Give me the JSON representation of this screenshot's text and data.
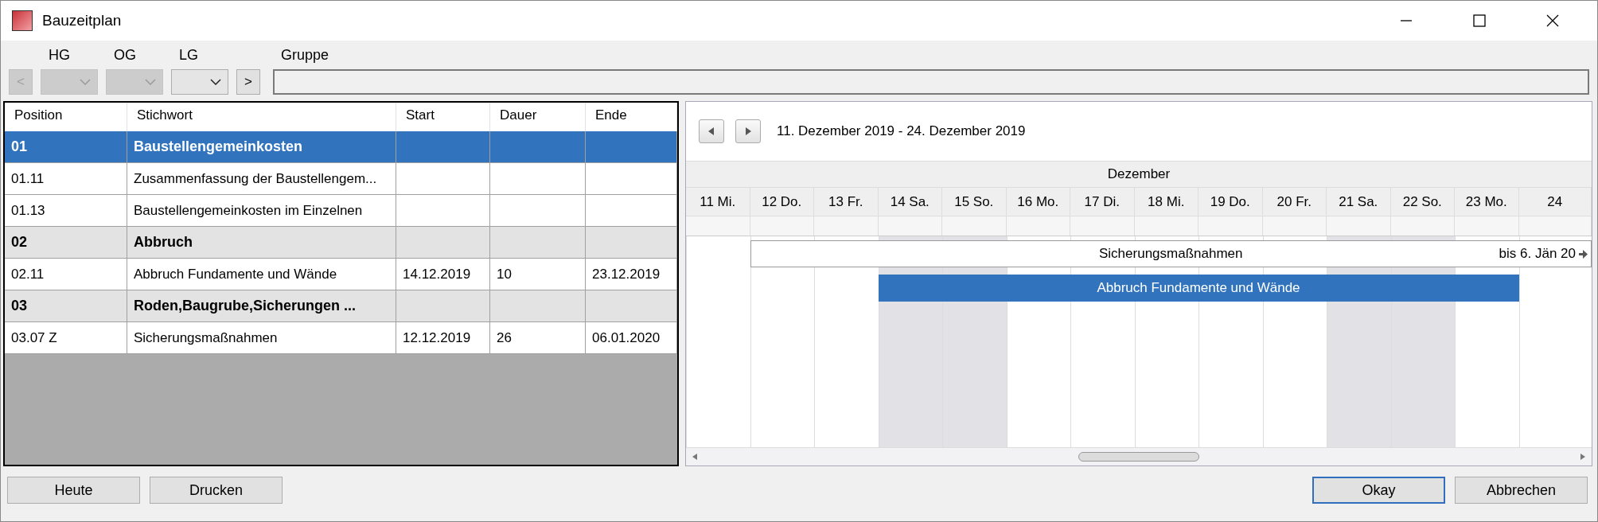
{
  "window": {
    "title": "Bauzeitplan"
  },
  "filters": [
    {
      "label": "HG",
      "disabled": true
    },
    {
      "label": "OG",
      "disabled": true
    },
    {
      "label": "LG",
      "disabled": false
    }
  ],
  "nav": {
    "prev": {
      "label": "<",
      "disabled": true
    },
    "next": {
      "label": ">",
      "disabled": false
    }
  },
  "group": {
    "label": "Gruppe"
  },
  "table": {
    "columns": [
      "Position",
      "Stichwort",
      "Start",
      "Dauer",
      "Ende"
    ],
    "rows": [
      {
        "kind": "group",
        "selected": true,
        "cells": [
          "01",
          "Baustellengemeinkosten",
          "",
          "",
          ""
        ]
      },
      {
        "kind": "item",
        "selected": false,
        "cells": [
          "01.11",
          "Zusammenfassung der Baustellengem...",
          "",
          "",
          ""
        ]
      },
      {
        "kind": "item",
        "selected": false,
        "cells": [
          "01.13",
          "Baustellengemeinkosten im Einzelnen",
          "",
          "",
          ""
        ]
      },
      {
        "kind": "group",
        "selected": false,
        "cells": [
          "02",
          "Abbruch",
          "",
          "",
          ""
        ]
      },
      {
        "kind": "item",
        "selected": false,
        "cells": [
          "02.11",
          "Abbruch Fundamente und Wände",
          "14.12.2019",
          "10",
          "23.12.2019"
        ]
      },
      {
        "kind": "group",
        "selected": false,
        "cells": [
          "03",
          "Roden,Baugrube,Sicherungen ...",
          "",
          "",
          ""
        ]
      },
      {
        "kind": "item",
        "selected": false,
        "cells": [
          "03.07  Z",
          "Sicherungsmaßnahmen",
          "12.12.2019",
          "26",
          "06.01.2020"
        ]
      }
    ]
  },
  "gantt": {
    "range": "11. Dezember 2019 - 24. Dezember 2019",
    "month": "Dezember",
    "days": [
      {
        "label": "11 Mi.",
        "weekend": false
      },
      {
        "label": "12 Do.",
        "weekend": false
      },
      {
        "label": "13 Fr.",
        "weekend": false
      },
      {
        "label": "14 Sa.",
        "weekend": true
      },
      {
        "label": "15 So.",
        "weekend": true
      },
      {
        "label": "16 Mo.",
        "weekend": false
      },
      {
        "label": "17 Di.",
        "weekend": false
      },
      {
        "label": "18 Mi.",
        "weekend": false
      },
      {
        "label": "19 Do.",
        "weekend": false
      },
      {
        "label": "20 Fr.",
        "weekend": false
      },
      {
        "label": "21 Sa.",
        "weekend": true
      },
      {
        "label": "22 So.",
        "weekend": true
      },
      {
        "label": "23 Mo.",
        "weekend": false
      },
      {
        "label": "24",
        "weekend": false
      }
    ],
    "bars": [
      {
        "kind": "outline",
        "label": "Sicherungsmaßnahmen",
        "continues": "bis 6. Jän 20"
      },
      {
        "kind": "filled",
        "label": "Abbruch Fundamente und Wände"
      }
    ]
  },
  "buttons": [
    {
      "label": "Heute",
      "default": false
    },
    {
      "label": "Drucken",
      "default": false
    },
    {
      "label": "Okay",
      "default": true
    },
    {
      "label": "Abbrechen",
      "default": false
    }
  ]
}
